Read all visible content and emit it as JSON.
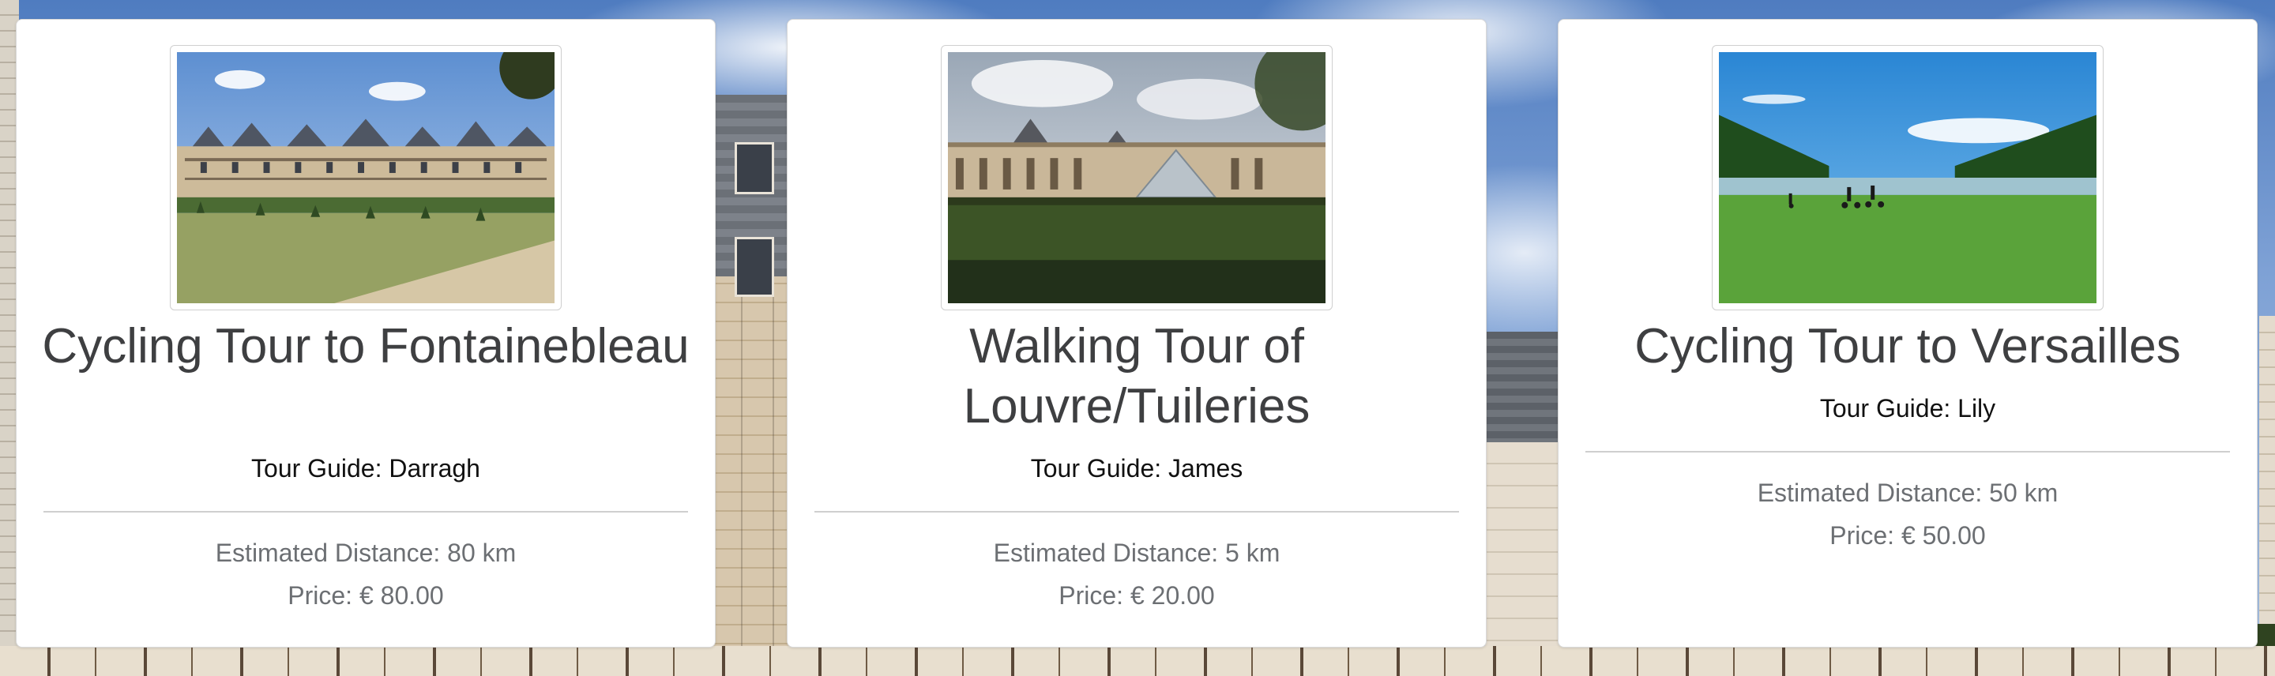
{
  "tours": [
    {
      "image_alt": "Château de Fontainebleau",
      "title": "Cycling Tour to Fontainebleau",
      "guide": "Tour Guide: Darragh",
      "distance": "Estimated Distance: 80 km",
      "price": "Price: € 80.00"
    },
    {
      "image_alt": "Louvre pyramid and Tuileries hedges",
      "title": "Walking Tour of Louvre/Tuileries",
      "guide": "Tour Guide: James",
      "distance": "Estimated Distance: 5 km",
      "price": "Price: € 20.00"
    },
    {
      "image_alt": "Grand Canal at Versailles with cyclists",
      "title": "Cycling Tour to Versailles",
      "guide": "Tour Guide: Lily",
      "distance": "Estimated Distance: 50 km",
      "price": "Price: € 50.00"
    }
  ]
}
